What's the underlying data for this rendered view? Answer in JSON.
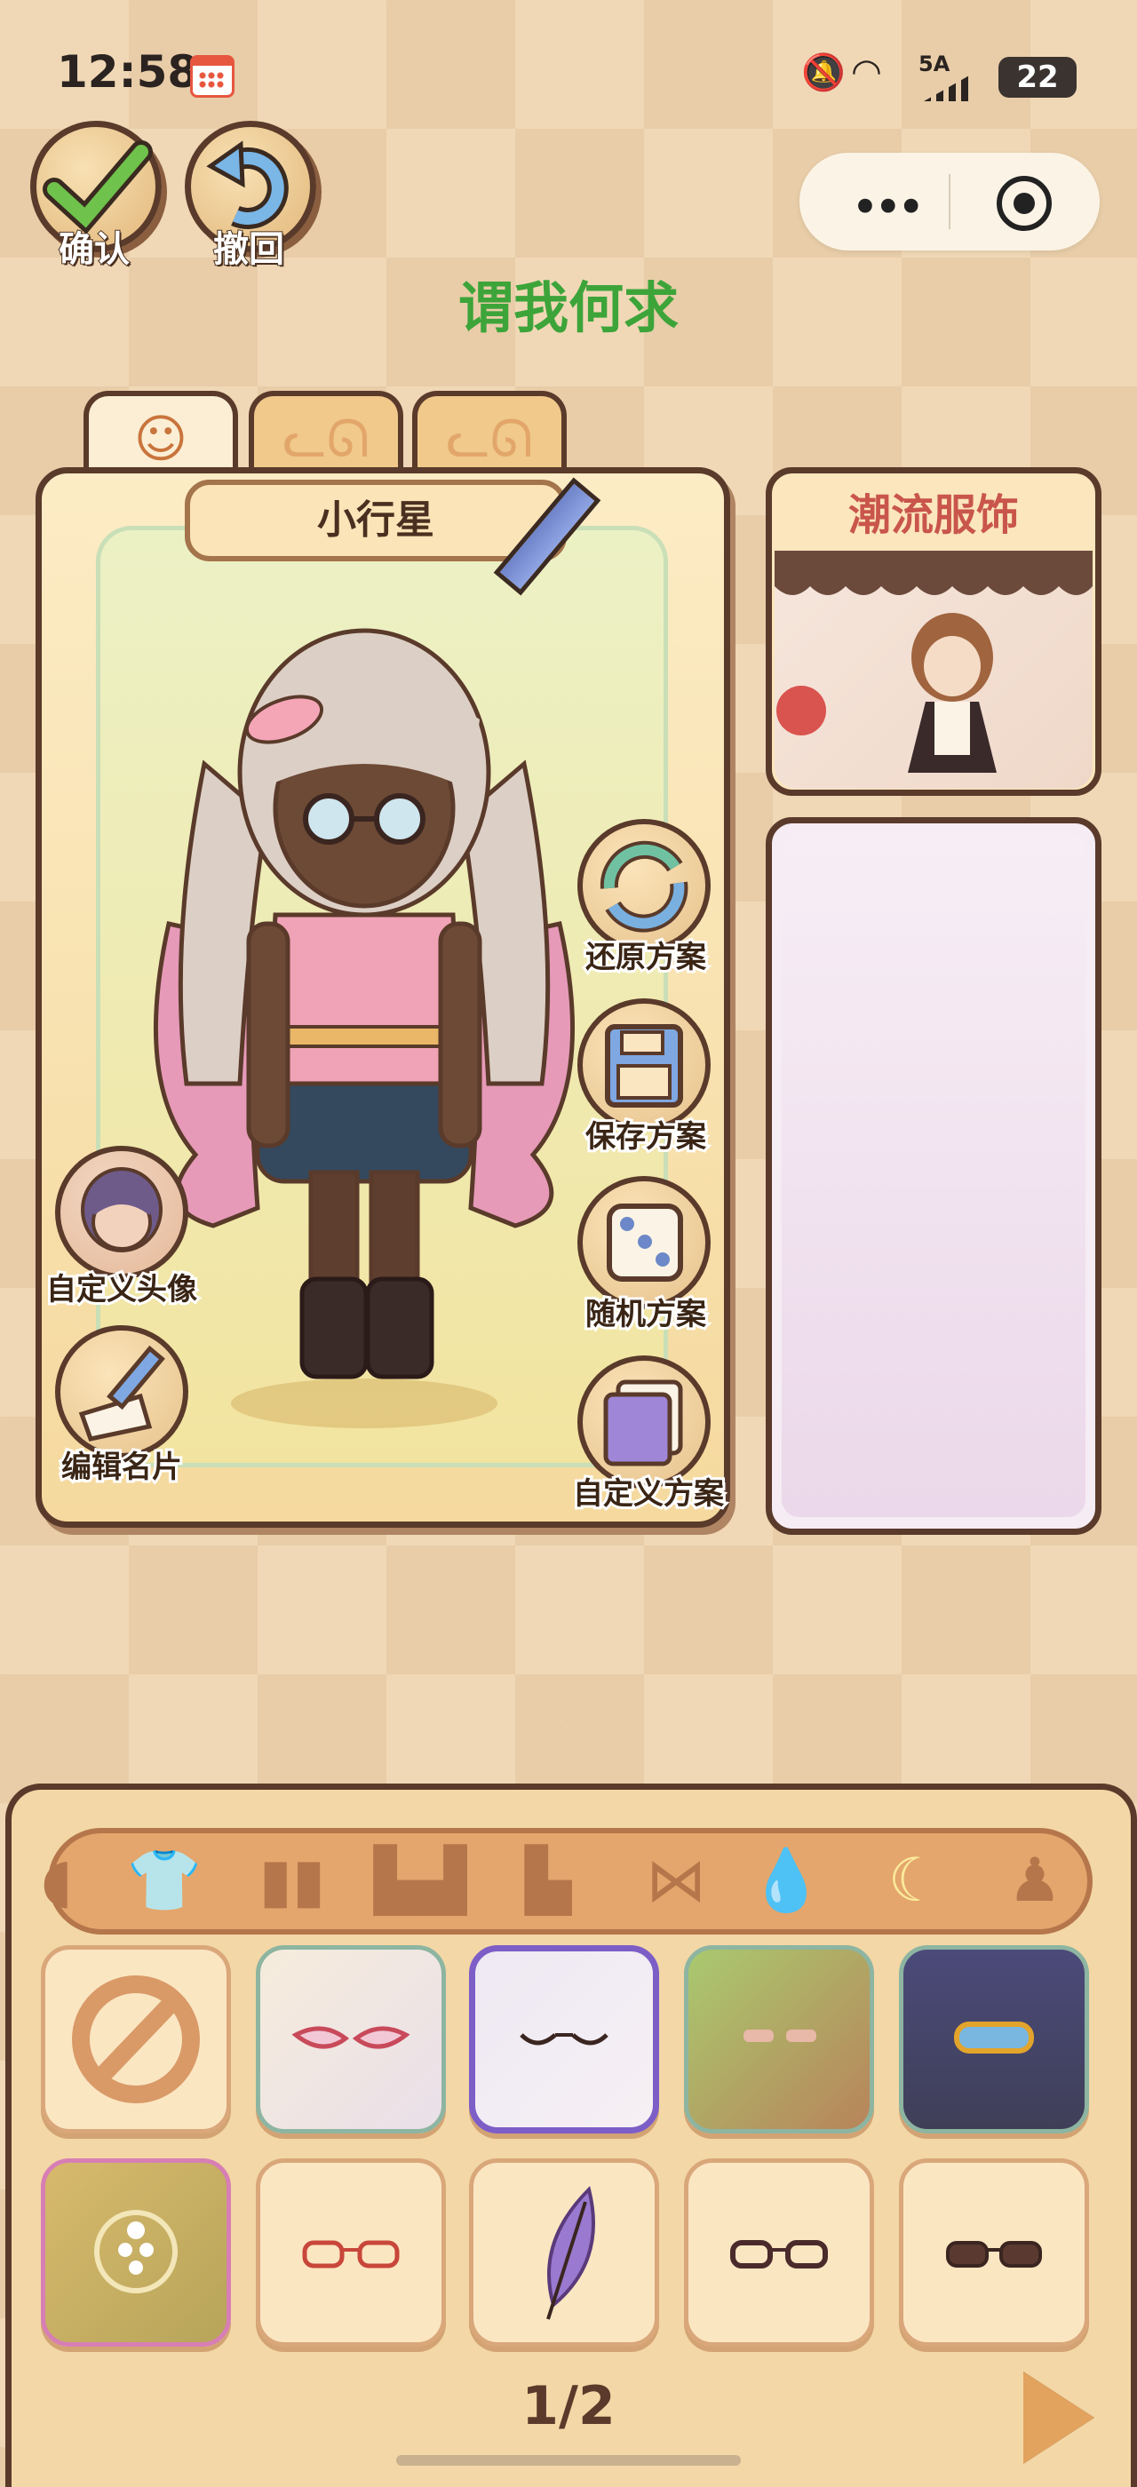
{
  "status_bar": {
    "time": "12:58",
    "network": "5A",
    "battery": "22"
  },
  "top_buttons": {
    "confirm": "确认",
    "undo": "撤回"
  },
  "subtitle": "谓我何求",
  "character": {
    "name": "小行星"
  },
  "side_actions": {
    "restore": "还原方案",
    "save": "保存方案",
    "random": "随机方案",
    "custom": "自定义方案"
  },
  "left_actions": {
    "avatar": "自定义头像",
    "card": "编辑名片"
  },
  "fashion": {
    "title": "潮流服饰"
  },
  "pager": {
    "text": "1/2"
  },
  "colors": {
    "accent_green": "#3da43a",
    "border_brown": "#5a3a2a",
    "selected_purple": "#7d5ec7",
    "fashion_title": "#c9564a"
  }
}
